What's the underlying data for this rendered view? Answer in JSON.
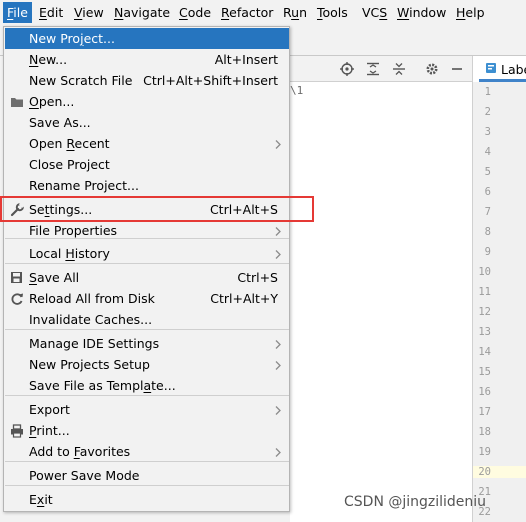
{
  "menubar": {
    "items": [
      {
        "pre": "",
        "mn": "F",
        "post": "ile"
      },
      {
        "pre": "",
        "mn": "E",
        "post": "dit"
      },
      {
        "pre": "",
        "mn": "V",
        "post": "iew"
      },
      {
        "pre": "",
        "mn": "N",
        "post": "avigate"
      },
      {
        "pre": "",
        "mn": "C",
        "post": "ode"
      },
      {
        "pre": "",
        "mn": "R",
        "post": "efactor"
      },
      {
        "pre": "R",
        "mn": "u",
        "post": "n"
      },
      {
        "pre": "",
        "mn": "T",
        "post": "ools"
      },
      {
        "pre": "VC",
        "mn": "S",
        "post": ""
      },
      {
        "pre": "",
        "mn": "W",
        "post": "indow"
      },
      {
        "pre": "",
        "mn": "H",
        "post": "elp"
      }
    ]
  },
  "file_menu": {
    "items": [
      {
        "pre": "New Pro",
        "mn": "j",
        "post": "ect...",
        "shortcut": "",
        "icon": "",
        "arrow": false
      },
      {
        "pre": "",
        "mn": "N",
        "post": "ew...",
        "shortcut": "Alt+Insert",
        "icon": "",
        "arrow": false
      },
      {
        "pre": "New Scratch File",
        "mn": "",
        "post": "",
        "shortcut": "Ctrl+Alt+Shift+Insert",
        "icon": "",
        "arrow": false
      },
      {
        "pre": "",
        "mn": "O",
        "post": "pen...",
        "shortcut": "",
        "icon": "folder-icon",
        "arrow": false
      },
      {
        "pre": "Save As...",
        "mn": "",
        "post": "",
        "shortcut": "",
        "icon": "",
        "arrow": false
      },
      {
        "pre": "Open ",
        "mn": "R",
        "post": "ecent",
        "shortcut": "",
        "icon": "",
        "arrow": true
      },
      {
        "pre": "Close Project",
        "mn": "",
        "post": "",
        "shortcut": "",
        "icon": "",
        "arrow": false
      },
      {
        "pre": "Rename Project...",
        "mn": "",
        "post": "",
        "shortcut": "",
        "icon": "",
        "arrow": false
      },
      {
        "pre": "Se",
        "mn": "t",
        "post": "tings...",
        "shortcut": "Ctrl+Alt+S",
        "icon": "wrench-icon",
        "arrow": false
      },
      {
        "pre": "File Properties",
        "mn": "",
        "post": "",
        "shortcut": "",
        "icon": "",
        "arrow": true
      },
      {
        "pre": "Local ",
        "mn": "H",
        "post": "istory",
        "shortcut": "",
        "icon": "",
        "arrow": true
      },
      {
        "pre": "",
        "mn": "S",
        "post": "ave All",
        "shortcut": "Ctrl+S",
        "icon": "save-icon",
        "arrow": false
      },
      {
        "pre": "Reload All from Disk",
        "mn": "",
        "post": "",
        "shortcut": "Ctrl+Alt+Y",
        "icon": "reload-icon",
        "arrow": false
      },
      {
        "pre": "Invalidate Caches...",
        "mn": "",
        "post": "",
        "shortcut": "",
        "icon": "",
        "arrow": false
      },
      {
        "pre": "Manage IDE Settings",
        "mn": "",
        "post": "",
        "shortcut": "",
        "icon": "",
        "arrow": true
      },
      {
        "pre": "New Projects Setup",
        "mn": "",
        "post": "",
        "shortcut": "",
        "icon": "",
        "arrow": true
      },
      {
        "pre": "Save File as Templ",
        "mn": "a",
        "post": "te...",
        "shortcut": "",
        "icon": "",
        "arrow": false
      },
      {
        "pre": "Export",
        "mn": "",
        "post": "",
        "shortcut": "",
        "icon": "",
        "arrow": true
      },
      {
        "pre": "",
        "mn": "P",
        "post": "rint...",
        "shortcut": "",
        "icon": "printer-icon",
        "arrow": false
      },
      {
        "pre": "Add to ",
        "mn": "F",
        "post": "avorites",
        "shortcut": "",
        "icon": "",
        "arrow": true
      },
      {
        "pre": "Power Save Mode",
        "mn": "",
        "post": "",
        "shortcut": "",
        "icon": "",
        "arrow": false
      },
      {
        "pre": "E",
        "mn": "x",
        "post": "it",
        "shortcut": "",
        "icon": "",
        "arrow": false
      }
    ]
  },
  "editor": {
    "tab_label": "Labe",
    "line_numbers": [
      "1",
      "2",
      "3",
      "4",
      "5",
      "6",
      "7",
      "8",
      "9",
      "10",
      "11",
      "12",
      "13",
      "14",
      "15",
      "16",
      "17",
      "18",
      "19",
      "20",
      "21",
      "22"
    ]
  },
  "background": {
    "path_text": "\\1"
  },
  "watermark": "CSDN @jingzilideniu",
  "colors": {
    "selection": "#2675bf",
    "highlight_box": "#e53935",
    "menu_bg": "#f2f2f2"
  }
}
